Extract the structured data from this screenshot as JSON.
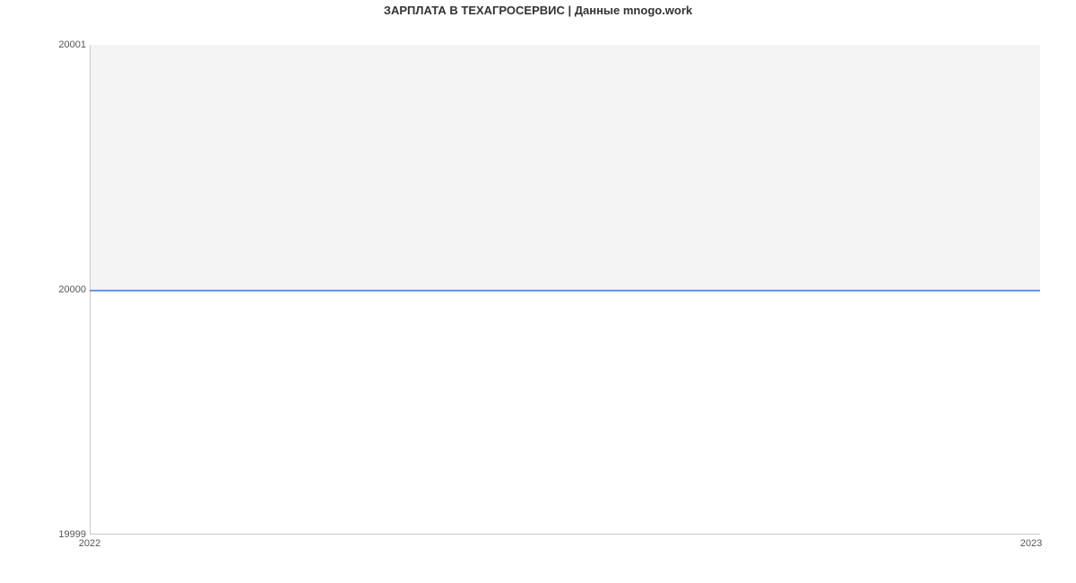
{
  "chart_data": {
    "type": "line",
    "title": "ЗАРПЛАТА В ТЕХАГРОСЕРВИС | Данные mnogo.work",
    "xlabel": "",
    "ylabel": "",
    "x": [
      2022,
      2023
    ],
    "values": [
      20000,
      20000
    ],
    "xlim": [
      2022,
      2023
    ],
    "ylim": [
      19999,
      20001
    ],
    "xticks": [
      {
        "value": 2022,
        "label": "2022"
      },
      {
        "value": 2023,
        "label": "2023"
      }
    ],
    "yticks": [
      {
        "value": 19999,
        "label": "19999"
      },
      {
        "value": 20000,
        "label": "20000"
      },
      {
        "value": 20001,
        "label": "20001"
      }
    ],
    "line_color": "#6699e2",
    "fill_color": "#f4f4f4"
  }
}
